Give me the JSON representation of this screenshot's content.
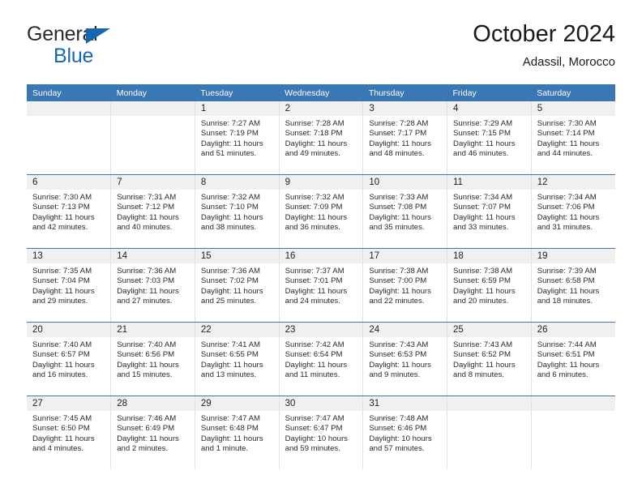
{
  "brand": {
    "name_part1": "General",
    "name_part2": "Blue",
    "triangle_color": "#1567b2",
    "text_color": "#2b2b2b"
  },
  "header": {
    "title": "October 2024",
    "subtitle": "Adassil, Morocco"
  },
  "theme": {
    "header_row_bg": "#3a77b5",
    "header_row_text": "#ffffff",
    "daynum_bg": "#f0f0f0",
    "cell_border": "#e2e2e2",
    "week_separator": "#3a77b5"
  },
  "weekdays": [
    "Sunday",
    "Monday",
    "Tuesday",
    "Wednesday",
    "Thursday",
    "Friday",
    "Saturday"
  ],
  "labels": {
    "sunrise_prefix": "Sunrise:",
    "sunset_prefix": "Sunset:",
    "daylight_prefix": "Daylight:"
  },
  "weeks": [
    [
      {
        "day": "",
        "sunrise": "",
        "sunset": "",
        "daylight_line1": "",
        "daylight_line2": "",
        "empty": true
      },
      {
        "day": "",
        "sunrise": "",
        "sunset": "",
        "daylight_line1": "",
        "daylight_line2": "",
        "empty": true
      },
      {
        "day": "1",
        "sunrise": "Sunrise: 7:27 AM",
        "sunset": "Sunset: 7:19 PM",
        "daylight_line1": "Daylight: 11 hours",
        "daylight_line2": "and 51 minutes."
      },
      {
        "day": "2",
        "sunrise": "Sunrise: 7:28 AM",
        "sunset": "Sunset: 7:18 PM",
        "daylight_line1": "Daylight: 11 hours",
        "daylight_line2": "and 49 minutes."
      },
      {
        "day": "3",
        "sunrise": "Sunrise: 7:28 AM",
        "sunset": "Sunset: 7:17 PM",
        "daylight_line1": "Daylight: 11 hours",
        "daylight_line2": "and 48 minutes."
      },
      {
        "day": "4",
        "sunrise": "Sunrise: 7:29 AM",
        "sunset": "Sunset: 7:15 PM",
        "daylight_line1": "Daylight: 11 hours",
        "daylight_line2": "and 46 minutes."
      },
      {
        "day": "5",
        "sunrise": "Sunrise: 7:30 AM",
        "sunset": "Sunset: 7:14 PM",
        "daylight_line1": "Daylight: 11 hours",
        "daylight_line2": "and 44 minutes."
      }
    ],
    [
      {
        "day": "6",
        "sunrise": "Sunrise: 7:30 AM",
        "sunset": "Sunset: 7:13 PM",
        "daylight_line1": "Daylight: 11 hours",
        "daylight_line2": "and 42 minutes."
      },
      {
        "day": "7",
        "sunrise": "Sunrise: 7:31 AM",
        "sunset": "Sunset: 7:12 PM",
        "daylight_line1": "Daylight: 11 hours",
        "daylight_line2": "and 40 minutes."
      },
      {
        "day": "8",
        "sunrise": "Sunrise: 7:32 AM",
        "sunset": "Sunset: 7:10 PM",
        "daylight_line1": "Daylight: 11 hours",
        "daylight_line2": "and 38 minutes."
      },
      {
        "day": "9",
        "sunrise": "Sunrise: 7:32 AM",
        "sunset": "Sunset: 7:09 PM",
        "daylight_line1": "Daylight: 11 hours",
        "daylight_line2": "and 36 minutes."
      },
      {
        "day": "10",
        "sunrise": "Sunrise: 7:33 AM",
        "sunset": "Sunset: 7:08 PM",
        "daylight_line1": "Daylight: 11 hours",
        "daylight_line2": "and 35 minutes."
      },
      {
        "day": "11",
        "sunrise": "Sunrise: 7:34 AM",
        "sunset": "Sunset: 7:07 PM",
        "daylight_line1": "Daylight: 11 hours",
        "daylight_line2": "and 33 minutes."
      },
      {
        "day": "12",
        "sunrise": "Sunrise: 7:34 AM",
        "sunset": "Sunset: 7:06 PM",
        "daylight_line1": "Daylight: 11 hours",
        "daylight_line2": "and 31 minutes."
      }
    ],
    [
      {
        "day": "13",
        "sunrise": "Sunrise: 7:35 AM",
        "sunset": "Sunset: 7:04 PM",
        "daylight_line1": "Daylight: 11 hours",
        "daylight_line2": "and 29 minutes."
      },
      {
        "day": "14",
        "sunrise": "Sunrise: 7:36 AM",
        "sunset": "Sunset: 7:03 PM",
        "daylight_line1": "Daylight: 11 hours",
        "daylight_line2": "and 27 minutes."
      },
      {
        "day": "15",
        "sunrise": "Sunrise: 7:36 AM",
        "sunset": "Sunset: 7:02 PM",
        "daylight_line1": "Daylight: 11 hours",
        "daylight_line2": "and 25 minutes."
      },
      {
        "day": "16",
        "sunrise": "Sunrise: 7:37 AM",
        "sunset": "Sunset: 7:01 PM",
        "daylight_line1": "Daylight: 11 hours",
        "daylight_line2": "and 24 minutes."
      },
      {
        "day": "17",
        "sunrise": "Sunrise: 7:38 AM",
        "sunset": "Sunset: 7:00 PM",
        "daylight_line1": "Daylight: 11 hours",
        "daylight_line2": "and 22 minutes."
      },
      {
        "day": "18",
        "sunrise": "Sunrise: 7:38 AM",
        "sunset": "Sunset: 6:59 PM",
        "daylight_line1": "Daylight: 11 hours",
        "daylight_line2": "and 20 minutes."
      },
      {
        "day": "19",
        "sunrise": "Sunrise: 7:39 AM",
        "sunset": "Sunset: 6:58 PM",
        "daylight_line1": "Daylight: 11 hours",
        "daylight_line2": "and 18 minutes."
      }
    ],
    [
      {
        "day": "20",
        "sunrise": "Sunrise: 7:40 AM",
        "sunset": "Sunset: 6:57 PM",
        "daylight_line1": "Daylight: 11 hours",
        "daylight_line2": "and 16 minutes."
      },
      {
        "day": "21",
        "sunrise": "Sunrise: 7:40 AM",
        "sunset": "Sunset: 6:56 PM",
        "daylight_line1": "Daylight: 11 hours",
        "daylight_line2": "and 15 minutes."
      },
      {
        "day": "22",
        "sunrise": "Sunrise: 7:41 AM",
        "sunset": "Sunset: 6:55 PM",
        "daylight_line1": "Daylight: 11 hours",
        "daylight_line2": "and 13 minutes."
      },
      {
        "day": "23",
        "sunrise": "Sunrise: 7:42 AM",
        "sunset": "Sunset: 6:54 PM",
        "daylight_line1": "Daylight: 11 hours",
        "daylight_line2": "and 11 minutes."
      },
      {
        "day": "24",
        "sunrise": "Sunrise: 7:43 AM",
        "sunset": "Sunset: 6:53 PM",
        "daylight_line1": "Daylight: 11 hours",
        "daylight_line2": "and 9 minutes."
      },
      {
        "day": "25",
        "sunrise": "Sunrise: 7:43 AM",
        "sunset": "Sunset: 6:52 PM",
        "daylight_line1": "Daylight: 11 hours",
        "daylight_line2": "and 8 minutes."
      },
      {
        "day": "26",
        "sunrise": "Sunrise: 7:44 AM",
        "sunset": "Sunset: 6:51 PM",
        "daylight_line1": "Daylight: 11 hours",
        "daylight_line2": "and 6 minutes."
      }
    ],
    [
      {
        "day": "27",
        "sunrise": "Sunrise: 7:45 AM",
        "sunset": "Sunset: 6:50 PM",
        "daylight_line1": "Daylight: 11 hours",
        "daylight_line2": "and 4 minutes."
      },
      {
        "day": "28",
        "sunrise": "Sunrise: 7:46 AM",
        "sunset": "Sunset: 6:49 PM",
        "daylight_line1": "Daylight: 11 hours",
        "daylight_line2": "and 2 minutes."
      },
      {
        "day": "29",
        "sunrise": "Sunrise: 7:47 AM",
        "sunset": "Sunset: 6:48 PM",
        "daylight_line1": "Daylight: 11 hours",
        "daylight_line2": "and 1 minute."
      },
      {
        "day": "30",
        "sunrise": "Sunrise: 7:47 AM",
        "sunset": "Sunset: 6:47 PM",
        "daylight_line1": "Daylight: 10 hours",
        "daylight_line2": "and 59 minutes."
      },
      {
        "day": "31",
        "sunrise": "Sunrise: 7:48 AM",
        "sunset": "Sunset: 6:46 PM",
        "daylight_line1": "Daylight: 10 hours",
        "daylight_line2": "and 57 minutes."
      },
      {
        "day": "",
        "sunrise": "",
        "sunset": "",
        "daylight_line1": "",
        "daylight_line2": "",
        "empty": true
      },
      {
        "day": "",
        "sunrise": "",
        "sunset": "",
        "daylight_line1": "",
        "daylight_line2": "",
        "empty": true
      }
    ]
  ]
}
